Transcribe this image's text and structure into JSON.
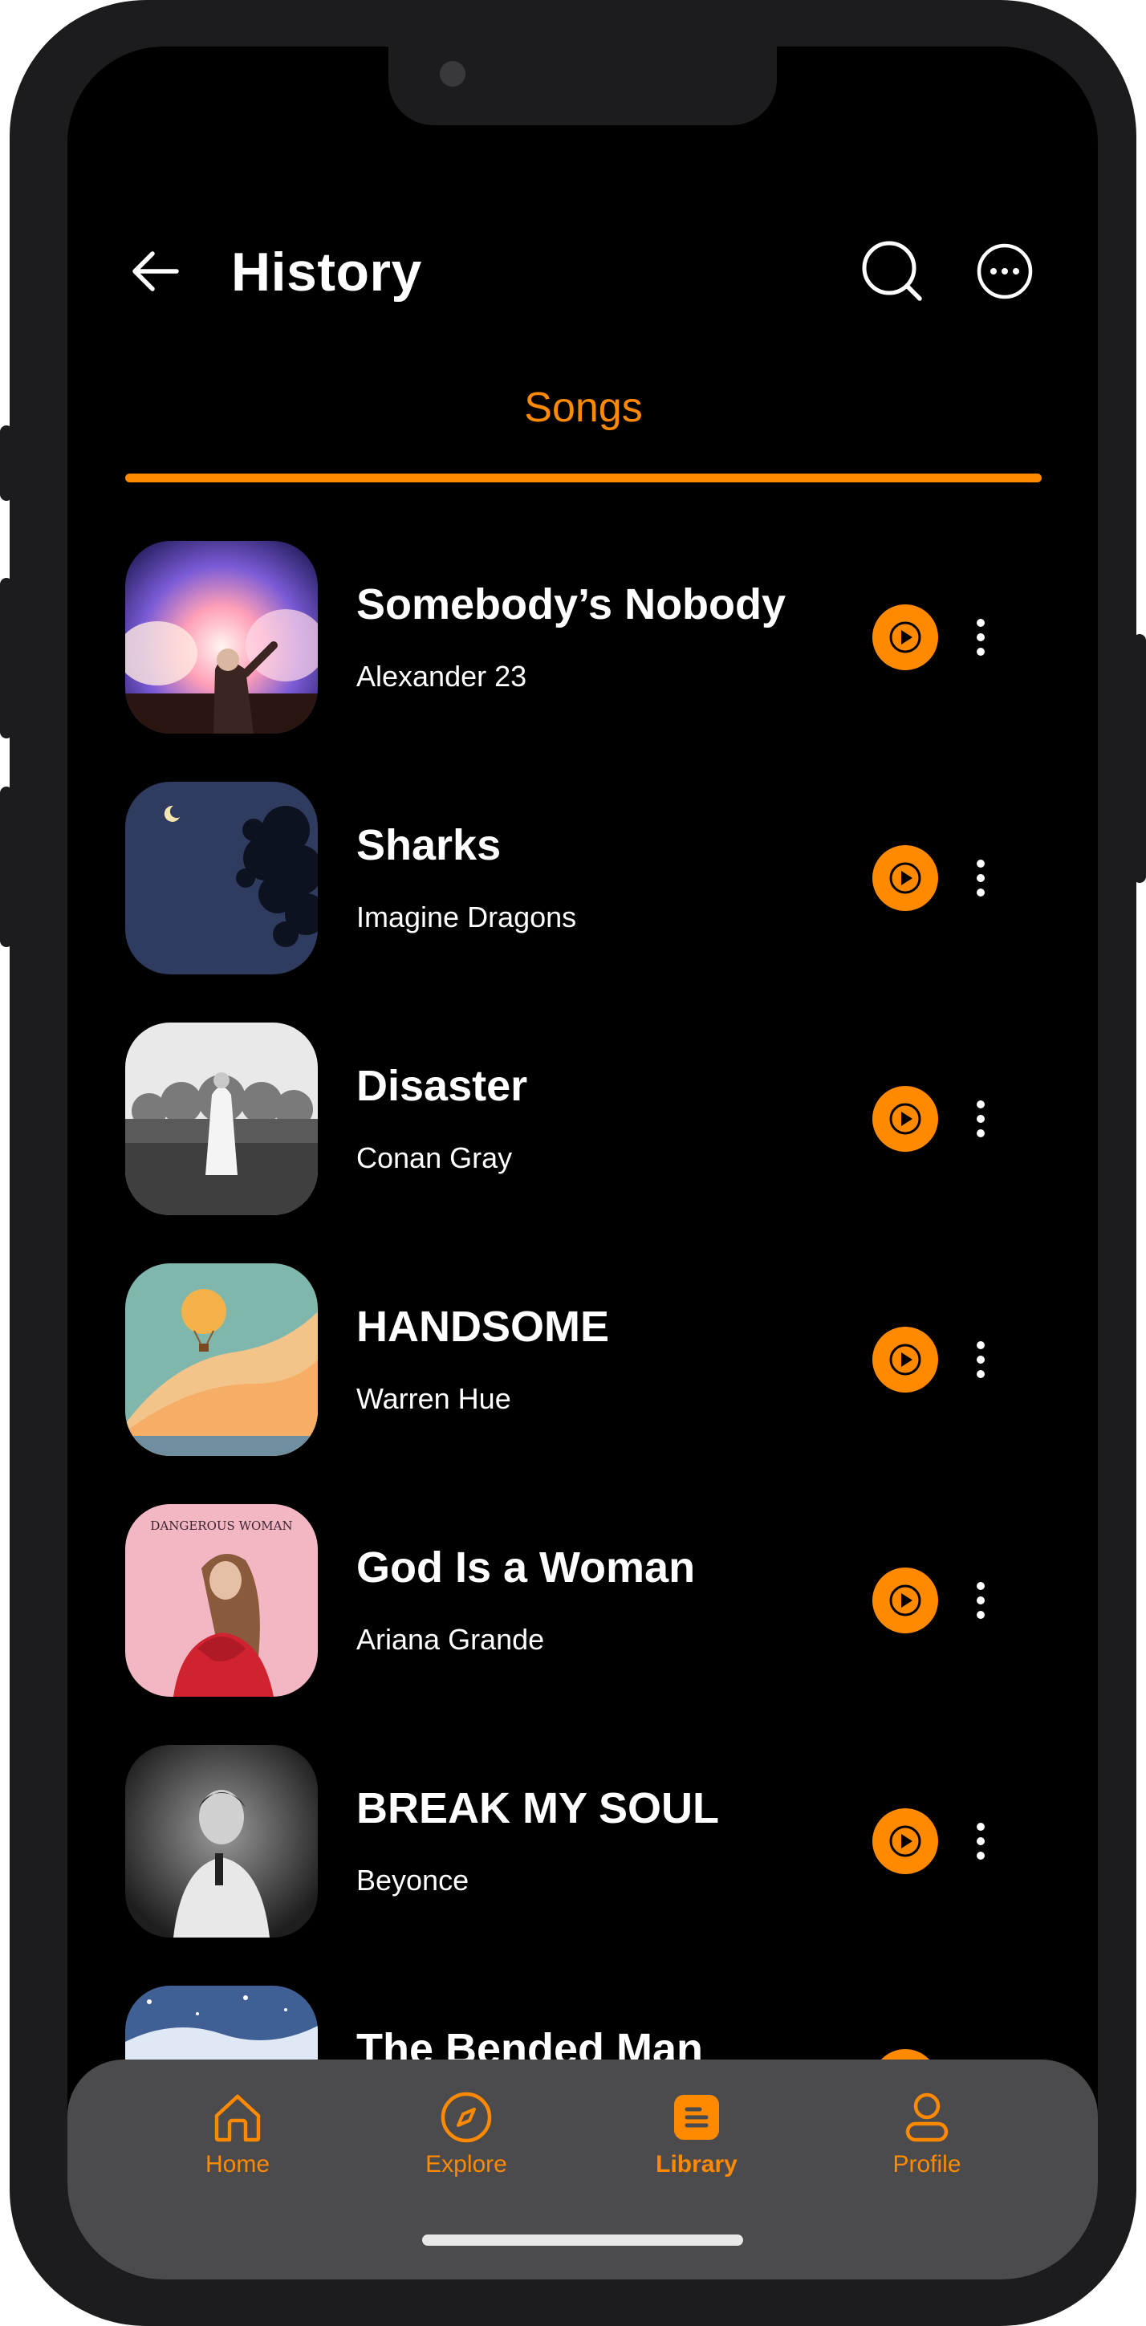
{
  "colors": {
    "accent": "#ff8a00",
    "background": "#000000",
    "nav_background": "#4b4a4c"
  },
  "header": {
    "title": "History",
    "back_icon": "arrow-left-icon",
    "search_icon": "search-icon",
    "more_icon": "more-horizontal-icon"
  },
  "tabs": [
    {
      "label": "Songs",
      "active": true
    }
  ],
  "songs": [
    {
      "title": "Somebody’s Nobody",
      "artist": "Alexander 23",
      "cover": "concert-crowd-cover"
    },
    {
      "title": "Sharks",
      "artist": "Imagine Dragons",
      "cover": "night-sky-tree-cover"
    },
    {
      "title": "Disaster",
      "artist": "Conan Gray",
      "cover": "grass-field-cover"
    },
    {
      "title": "HANDSOME",
      "artist": "Warren Hue",
      "cover": "hot-air-balloon-cover"
    },
    {
      "title": "God Is a Woman",
      "artist": "Ariana Grande",
      "cover": "dangerous-woman-cover",
      "cover_text": "DANGEROUS WOMAN"
    },
    {
      "title": "BREAK MY SOUL",
      "artist": "Beyonce",
      "cover": "black-white-portrait-cover"
    },
    {
      "title": "The Bended Man",
      "artist": "",
      "cover": "snowy-night-cover"
    }
  ],
  "bottom_nav": [
    {
      "label": "Home",
      "icon": "home-icon",
      "active": false
    },
    {
      "label": "Explore",
      "icon": "compass-icon",
      "active": false
    },
    {
      "label": "Library",
      "icon": "library-icon",
      "active": true
    },
    {
      "label": "Profile",
      "icon": "profile-icon",
      "active": false
    }
  ]
}
